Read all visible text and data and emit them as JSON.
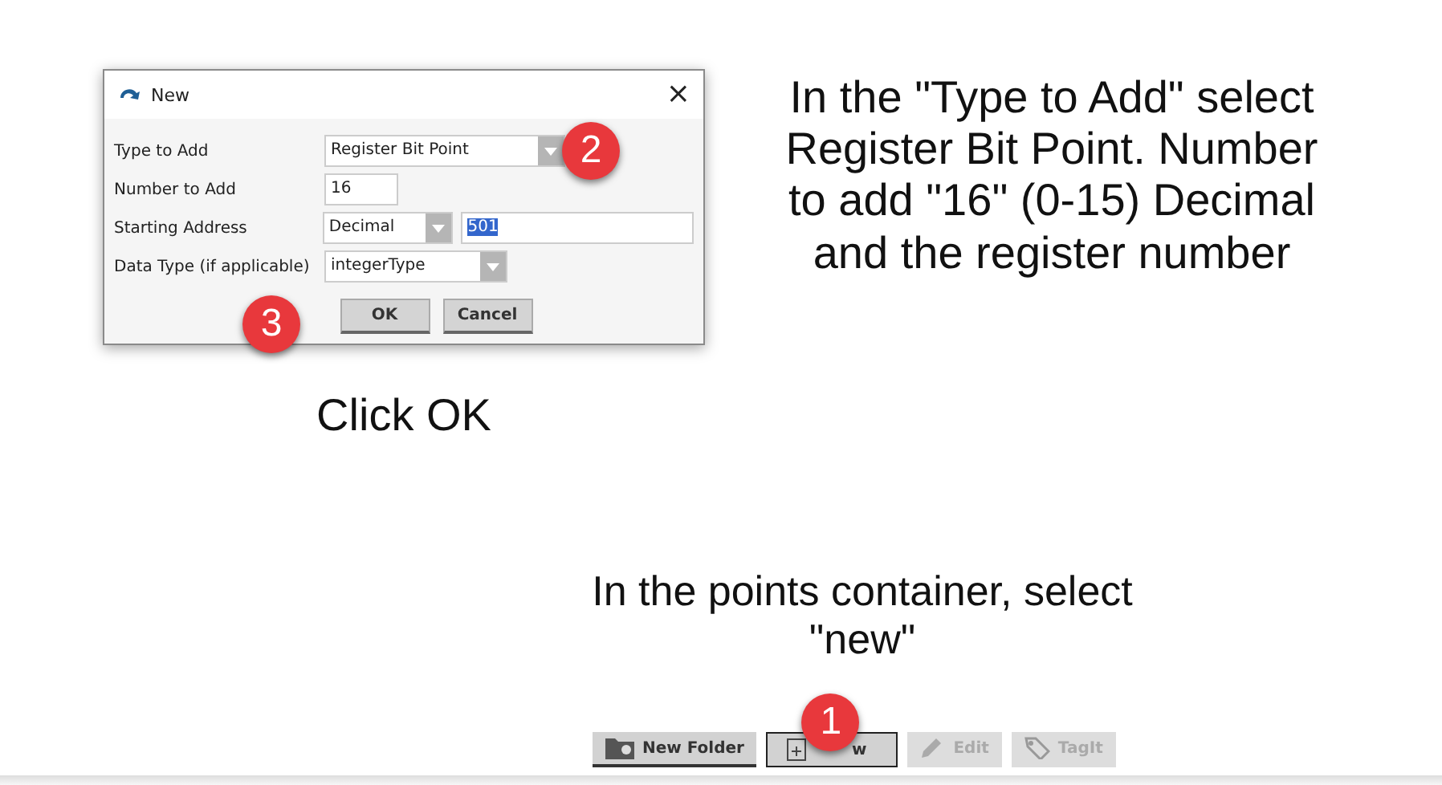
{
  "dialog": {
    "title": "New",
    "close": "×",
    "fields": [
      {
        "label": "Type to Add",
        "kind": "dropdown",
        "value": "Register Bit Point",
        "badge": "2"
      },
      {
        "label": "Number to Add",
        "kind": "text",
        "value": "16"
      },
      {
        "label": "Starting Address",
        "kind": "dropdown_text",
        "value": "Decimal",
        "value_2": "501",
        "value_2_selected": true
      },
      {
        "label": "Data Type (if applicable)",
        "kind": "dropdown",
        "value": "integerType"
      }
    ],
    "buttons": [
      "OK",
      "Cancel"
    ],
    "buttons_badge": "3"
  },
  "instruction": "In the \"Type to Add\" select Register Bit Point. Number to add \"16\" (0-15) Decimal and the register number",
  "dialog_caption": "Click OK",
  "toolbar_caption": "In the points container, select \"new\"",
  "toolbar": [
    {
      "label": "New Folder",
      "kind": "folder",
      "disabled": false,
      "focused": false
    },
    {
      "label": "w",
      "kind": "new",
      "disabled": false,
      "focused": true,
      "badge": "1"
    },
    {
      "label": "Edit",
      "kind": "pencil",
      "disabled": true,
      "focused": false
    },
    {
      "label": "TagIt",
      "kind": "tag",
      "disabled": true,
      "focused": false
    }
  ]
}
